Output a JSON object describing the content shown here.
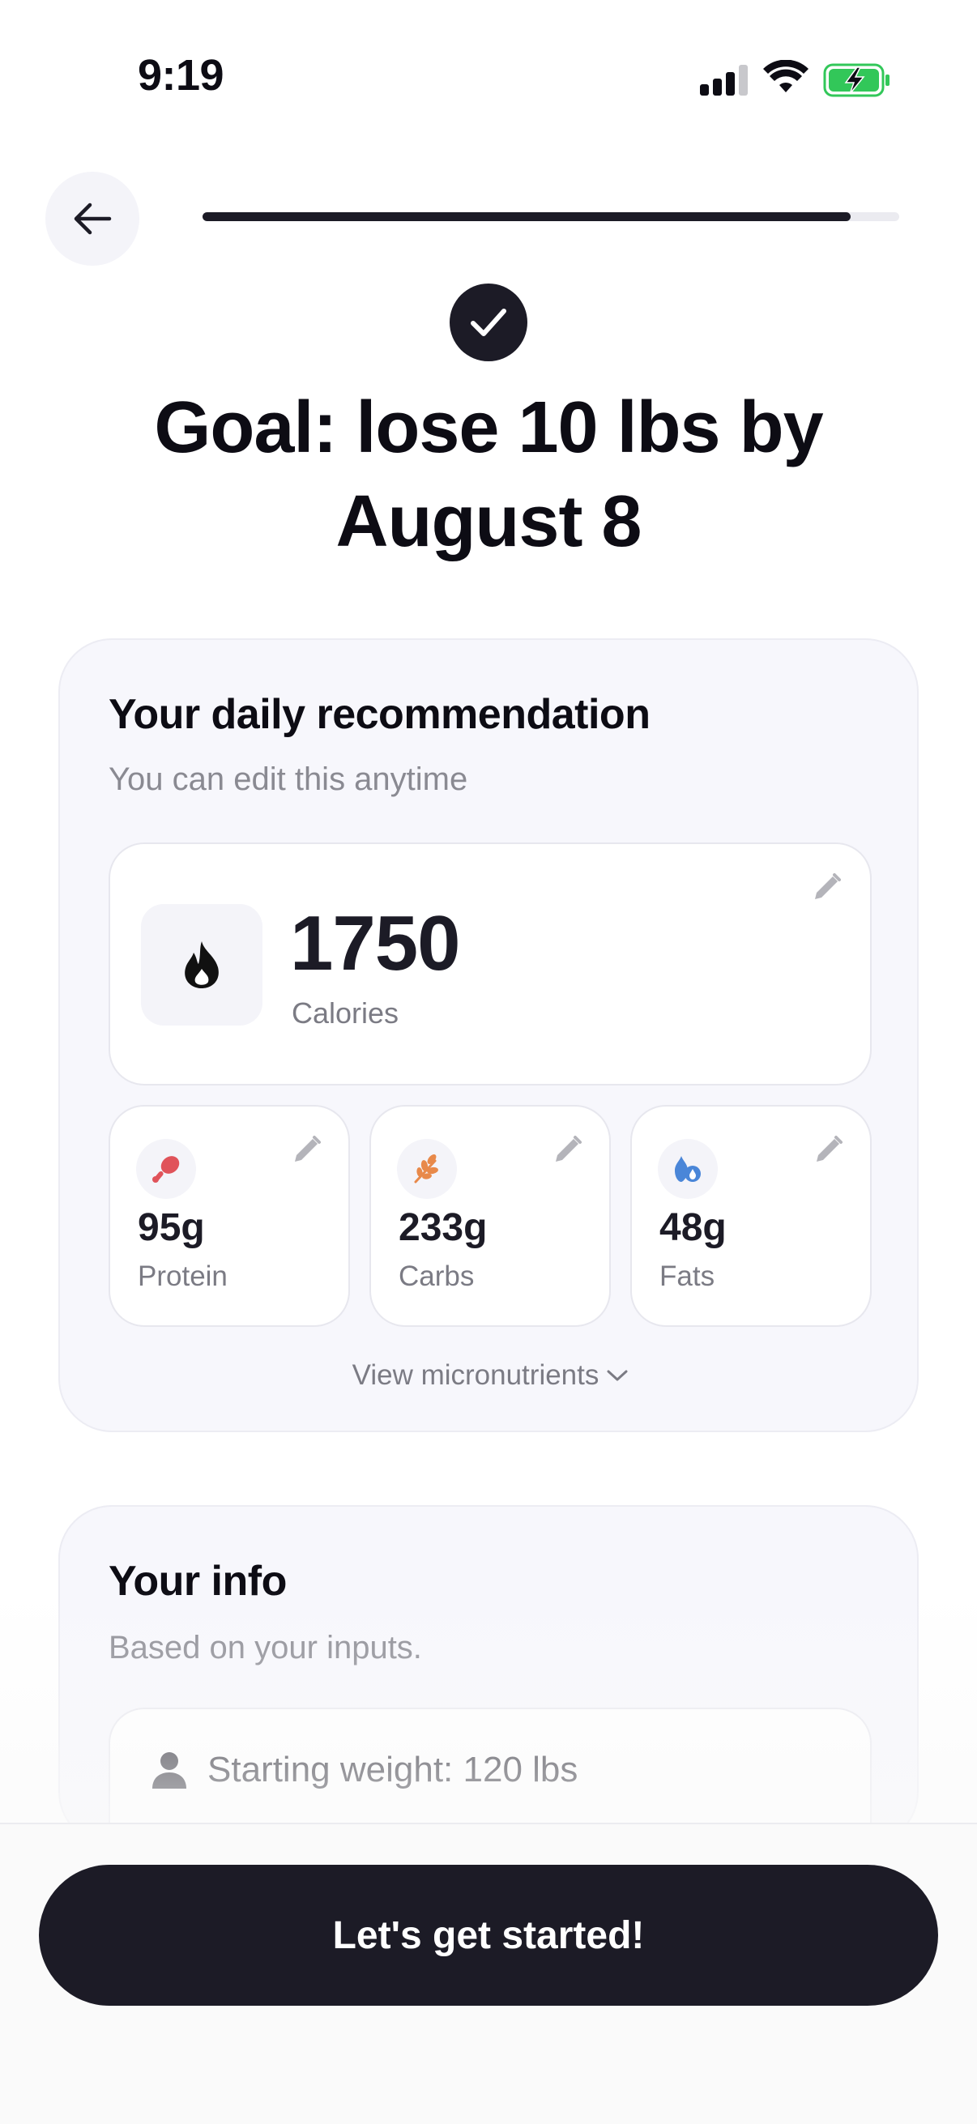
{
  "status_bar": {
    "time": "9:19",
    "icons": [
      "cellular-signal-icon",
      "wifi-icon",
      "battery-charging-icon"
    ]
  },
  "header": {
    "back_icon": "arrow-left-icon",
    "progress": 0.93
  },
  "goal": {
    "check_icon": "checkmark-icon",
    "title": "Goal: lose 10 lbs by August 8"
  },
  "recommendation": {
    "title": "Your daily recommendation",
    "subtitle": "You can edit this anytime",
    "calories": {
      "icon": "flame-icon",
      "value": "1750",
      "label": "Calories"
    },
    "macros": [
      {
        "icon": "drumstick-icon",
        "value": "95g",
        "label": "Protein",
        "color": "#e0535a"
      },
      {
        "icon": "wheat-icon",
        "value": "233g",
        "label": "Carbs",
        "color": "#e8894a"
      },
      {
        "icon": "oil-drop-icon",
        "value": "48g",
        "label": "Fats",
        "color": "#4a86d8"
      }
    ],
    "view_micronutrients": "View micronutrients"
  },
  "info": {
    "title": "Your info",
    "subtitle": "Based on your inputs.",
    "rows": [
      {
        "icon": "person-icon",
        "text": "Starting weight: 120 lbs"
      }
    ]
  },
  "cta": {
    "label": "Let's get started!"
  },
  "colors": {
    "primary": "#1c1b26",
    "card_bg": "#f7f7fc",
    "muted_text": "#7b7b84"
  }
}
